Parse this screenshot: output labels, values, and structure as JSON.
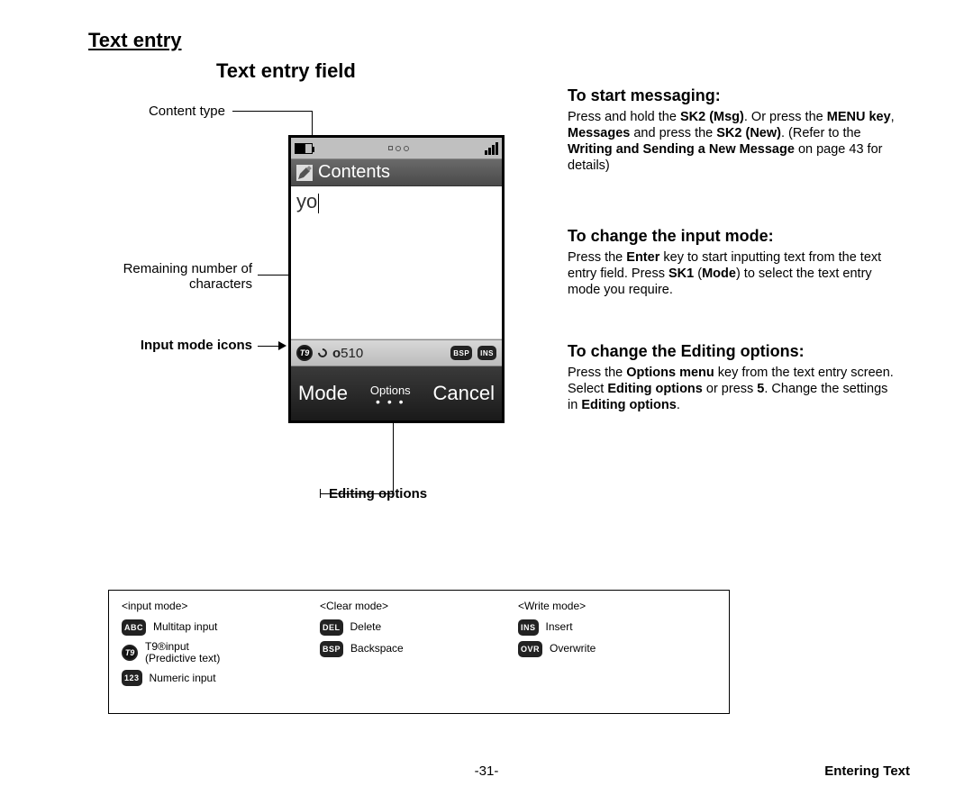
{
  "page": {
    "title": "Text entry",
    "section_title": "Text entry field",
    "page_number": "-31-",
    "footer_section": "Entering Text"
  },
  "labels": {
    "content_type": "Content type",
    "remaining_line1": "Remaining number of",
    "remaining_line2": "characters",
    "input_mode_icons": "Input mode icons",
    "editing_options": "Editing options"
  },
  "phone": {
    "header": "Contents",
    "entered_text": "yo",
    "char_count_prefix": "o",
    "char_count": "510",
    "icons": {
      "t9": "T9",
      "bsp": "BSP",
      "ins": "INS"
    },
    "softkeys": {
      "left": "Mode",
      "middle": "Options",
      "right": "Cancel"
    }
  },
  "instructions": {
    "start": {
      "heading": "To start messaging:",
      "body_parts": [
        "Press and hold the ",
        "SK2 (Msg)",
        ". Or press the ",
        "MENU key",
        ", ",
        "Messages",
        " and press the ",
        "SK2 (New)",
        ". (Refer to the ",
        "Writing and Sending a New Message",
        " on page 43 for details)"
      ]
    },
    "input_mode": {
      "heading": "To change the input mode:",
      "body_parts": [
        "Press the ",
        "Enter",
        " key to start inputting text from the text entry field. Press ",
        "SK1",
        " (",
        "Mode",
        ") to select the text entry mode you require."
      ]
    },
    "editing": {
      "heading": "To change the Editing options:",
      "body_parts": [
        "Press the ",
        "Options menu",
        " key from the text entry screen. Select ",
        "Editing options",
        " or press ",
        "5",
        ". Change the settings in ",
        "Editing options",
        "."
      ]
    }
  },
  "legend": {
    "columns": {
      "input_mode": {
        "header": "<input mode>",
        "items": [
          {
            "icon": "ABC",
            "label": "Multitap input"
          },
          {
            "icon": "T9",
            "label": "T9®input",
            "sublabel": "(Predictive text)"
          },
          {
            "icon": "123",
            "label": "Numeric input"
          }
        ]
      },
      "clear_mode": {
        "header": "<Clear mode>",
        "items": [
          {
            "icon": "DEL",
            "label": "Delete"
          },
          {
            "icon": "BSP",
            "label": "Backspace"
          }
        ]
      },
      "write_mode": {
        "header": "<Write mode>",
        "items": [
          {
            "icon": "INS",
            "label": "Insert"
          },
          {
            "icon": "OVR",
            "label": "Overwrite"
          }
        ]
      }
    }
  }
}
